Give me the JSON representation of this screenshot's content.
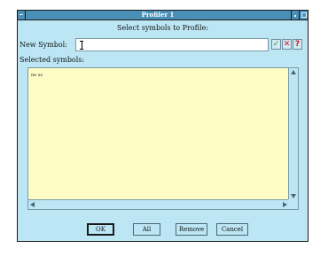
{
  "window": {
    "title": "Profiler 1",
    "prompt": "Select symbols to Profile:"
  },
  "new_symbol": {
    "label": "New Symbol:",
    "value": ""
  },
  "selected_symbols": {
    "label": "Selected symbols:",
    "items": [
      "ne ss"
    ]
  },
  "icons": {
    "accept": "check-icon",
    "delete": "x-icon",
    "help": "question-icon"
  },
  "buttons": {
    "ok": "OK",
    "all": "All",
    "remove": "Remove",
    "cancel": "Cancel"
  },
  "colors": {
    "window_bg": "#bde6f5",
    "titlebar_bg": "#4a8fb5",
    "list_bg": "#fdfcc5",
    "check_green": "#2e9e3e",
    "x_red": "#d01818",
    "question_red": "#d01818"
  }
}
